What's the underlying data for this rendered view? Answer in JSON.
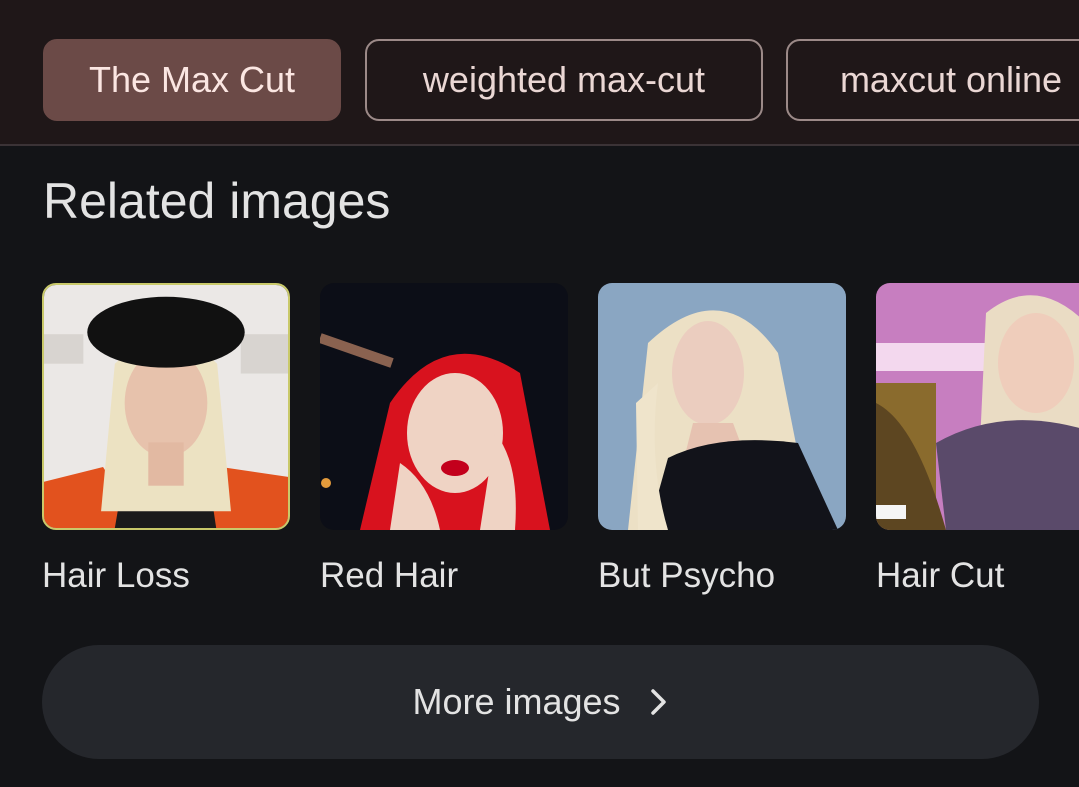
{
  "chips": [
    {
      "label": "The Max Cut",
      "active": true
    },
    {
      "label": "weighted max-cut",
      "active": false
    },
    {
      "label": "maxcut online",
      "active": false
    }
  ],
  "related": {
    "title": "Related images",
    "items": [
      {
        "label": "Hair Loss"
      },
      {
        "label": "Red Hair"
      },
      {
        "label": "But Psycho"
      },
      {
        "label": "Hair Cut"
      }
    ]
  },
  "more_button": {
    "label": "More images",
    "icon": "chevron-right-icon"
  },
  "colors": {
    "chip_active_bg": "#6b4a47",
    "chip_border": "#9c8a88",
    "page_bg": "#131417",
    "header_bg": "#1f1718",
    "button_bg": "#25272c"
  }
}
